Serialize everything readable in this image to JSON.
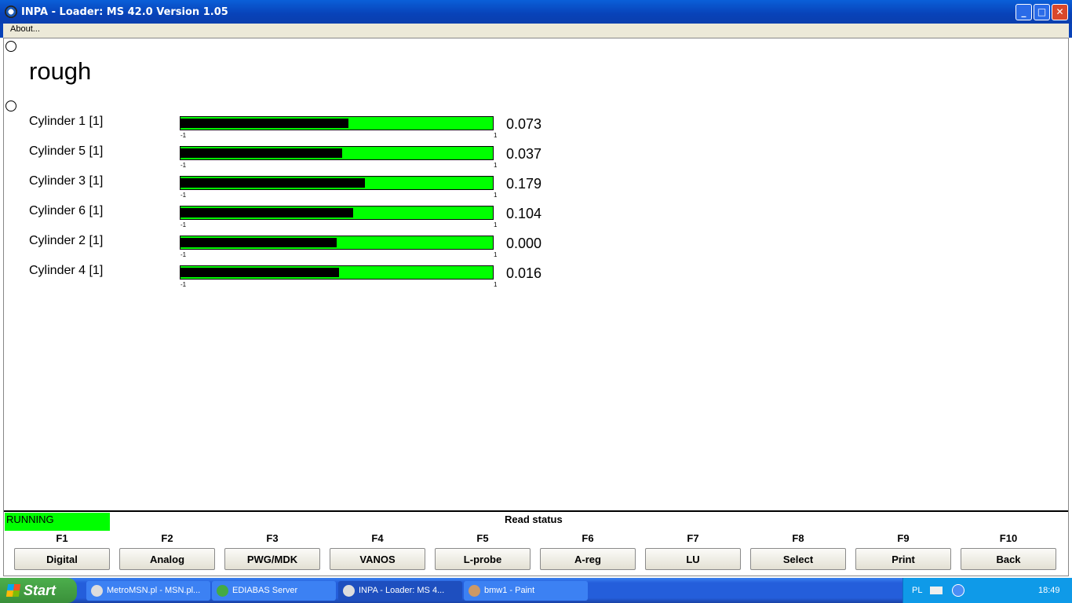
{
  "window": {
    "title": "INPA - Loader:  MS 42.0 Version 1.05",
    "menu": [
      "About..."
    ]
  },
  "heading": "rough",
  "scale": {
    "min": "-1",
    "max": "1"
  },
  "cylinders": [
    {
      "label": "Cylinder 1 [1]",
      "value": "0.073",
      "num": 0.073
    },
    {
      "label": "Cylinder 5 [1]",
      "value": "0.037",
      "num": 0.037
    },
    {
      "label": "Cylinder 3 [1]",
      "value": "0.179",
      "num": 0.179
    },
    {
      "label": "Cylinder 6 [1]",
      "value": "0.104",
      "num": 0.104
    },
    {
      "label": "Cylinder 2 [1]",
      "value": "0.000",
      "num": 0.0
    },
    {
      "label": "Cylinder 4 [1]",
      "value": "0.016",
      "num": 0.016
    }
  ],
  "status": {
    "state": "RUNNING",
    "read_status": "Read status"
  },
  "fkeys": [
    {
      "key": "F1",
      "label": "Digital"
    },
    {
      "key": "F2",
      "label": "Analog"
    },
    {
      "key": "F3",
      "label": "PWG/MDK"
    },
    {
      "key": "F4",
      "label": "VANOS"
    },
    {
      "key": "F5",
      "label": "L-probe"
    },
    {
      "key": "F6",
      "label": "A-reg"
    },
    {
      "key": "F7",
      "label": "LU"
    },
    {
      "key": "F8",
      "label": "Select"
    },
    {
      "key": "F9",
      "label": "Print"
    },
    {
      "key": "F10",
      "label": "Back"
    }
  ],
  "taskbar": {
    "start": "Start",
    "tasks": [
      "MetroMSN.pl - MSN.pl...",
      "EDIABAS Server",
      "INPA - Loader:  MS 4...",
      "bmw1 - Paint"
    ],
    "lang": "PL",
    "clock": "18:49"
  },
  "colors": {
    "bar": "#00ff00",
    "fill": "#000000",
    "status": "#00ff00"
  }
}
